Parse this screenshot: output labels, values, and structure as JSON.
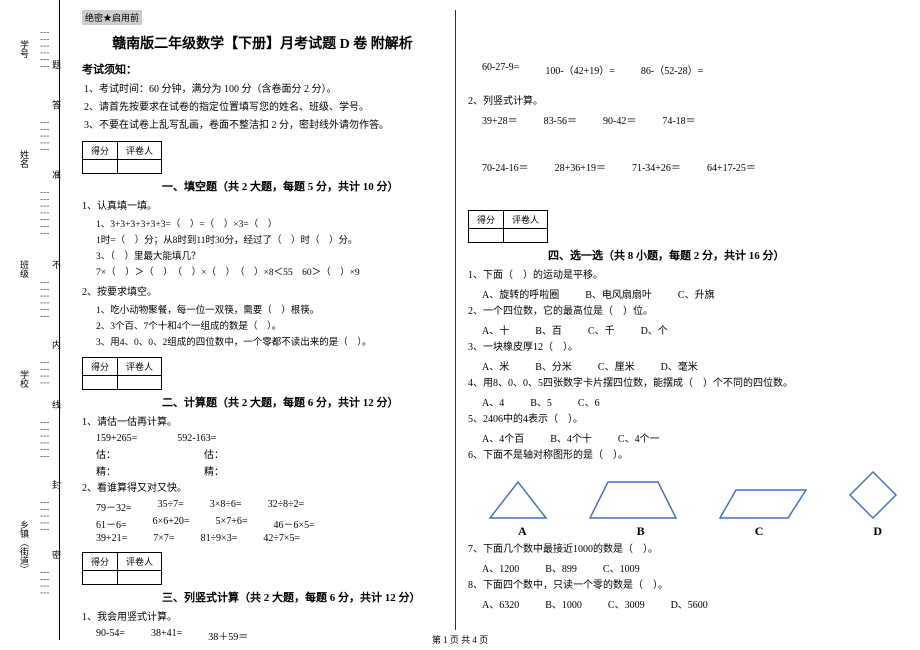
{
  "secret": "绝密★启用前",
  "title": "赣南版二年级数学【下册】月考试题 D 卷 附解析",
  "notice_head": "考试须知：",
  "notices": [
    "1、考试时间：60 分钟，满分为 100 分（含卷面分 2 分）。",
    "2、请首先按要求在试卷的指定位置填写您的姓名、班级、学号。",
    "3、不要在试卷上乱写乱画，卷面不整洁扣 2 分，密封线外请勿作答。"
  ],
  "score_labels": {
    "score": "得分",
    "reviewer": "评卷人"
  },
  "sections": {
    "s1": "一、填空题（共 2 大题，每题 5 分，共计 10 分）",
    "s2": "二、计算题（共 2 大题，每题 6 分，共计 12 分）",
    "s3": "三、列竖式计算（共 2 大题，每题 6 分，共计 12 分）",
    "s4": "四、选一选（共 8 小题，每题 2 分，共计 16 分）"
  },
  "q1": {
    "head": "1、认真填一填。",
    "a": "1、3+3+3+3+3+3=（　）=（　）×3=（　）",
    "b": "1时=（　）分；从8时到11时30分，经过了（　）时（　）分。",
    "c": "3、（　）里最大能填几？",
    "d": "7×（　）＞（　）　（　）×（　）　（　）×8＜55　60＞（　）×9"
  },
  "q2": {
    "head": "2、按要求填空。",
    "a": "1、吃小动物聚餐，每一位一双筷，需要（　）根筷。",
    "b": "2、3个百、7个十和4个一组成的数是（　）。",
    "c": "3、用4、0、0、2组成的四位数中，一个零都不读出来的是（　）。"
  },
  "calc1": {
    "head": "1、请估一估再计算。",
    "a1": "159+265=",
    "a2": "592-163=",
    "b1": "估：",
    "b2": "估：",
    "c1": "精：",
    "c2": "精："
  },
  "calc2": {
    "head": "2、看谁算得又对又快。",
    "r1": [
      "79－32=",
      "35÷7=",
      "3×8÷6=",
      "32÷8÷2="
    ],
    "r2": [
      "61－6=",
      "6×6+20=",
      "5×7+6=",
      "46－6×5="
    ],
    "r3": [
      "39+21=",
      "7×7=",
      "81÷9×3=",
      "42÷7×5="
    ]
  },
  "vert": {
    "head": "1、我会用竖式计算。",
    "r1": [
      "90-54=",
      "38+41=",
      "38＋59＝"
    ],
    "r2": [
      "60-27-9=",
      "100-（42+19）=",
      "86-（52-28）="
    ]
  },
  "vert2": {
    "head": "2、列竖式计算。",
    "r1": [
      "39+28＝",
      "83-56＝",
      "90-42＝",
      "74-18＝"
    ],
    "r2": [
      "70-24-16＝",
      "28+36+19＝",
      "71-34+26＝",
      "64+17-25＝"
    ]
  },
  "choice": {
    "q1": {
      "head": "1、下面（　）的运动是平移。",
      "a": "A、旋转的呼啦圈",
      "b": "B、电风扇扇叶",
      "c": "C、升旗"
    },
    "q2": {
      "head": "2、一个四位数，它的最高位是（　）位。",
      "a": "A、十",
      "b": "B、百",
      "c": "C、千",
      "d": "D、个"
    },
    "q3": {
      "head": "3、一块橡皮厚12（　）。",
      "a": "A、米",
      "b": "B、分米",
      "c": "C、厘米",
      "d": "D、毫米"
    },
    "q4": {
      "head": "4、用8、0、0、5四张数字卡片摆四位数，能摆成（　）个不同的四位数。",
      "a": "A、4",
      "b": "B、5",
      "c": "C、6"
    },
    "q5": {
      "head": "5、2406中的4表示（　）。",
      "a": "A、4个百",
      "b": "B、4个十",
      "c": "C、4个一"
    },
    "q6": {
      "head": "6、下面不是轴对称图形的是（　）。"
    },
    "shapes": {
      "a": "A",
      "b": "B",
      "c": "C",
      "d": "D"
    },
    "q7": {
      "head": "7、下面几个数中最接近1000的数是（　）。",
      "a": "A、1200",
      "b": "B、899",
      "c": "C、1009"
    },
    "q8": {
      "head": "8、下面四个数中，只读一个零的数是（　）。",
      "a": "A、6320",
      "b": "B、1000",
      "c": "C、3009",
      "d": "D、5600"
    }
  },
  "side": {
    "xuehaol": "学号",
    "xingming": "姓名",
    "banji": "班级",
    "xuexiao": "学校",
    "xiangzhen": "乡镇（街道）",
    "da": "答",
    "ti": "题",
    "zhun": "准",
    "bu": "不",
    "nei": "内",
    "xian": "线",
    "feng": "封",
    "mi": "密"
  },
  "footer": "第 1 页 共 4 页"
}
